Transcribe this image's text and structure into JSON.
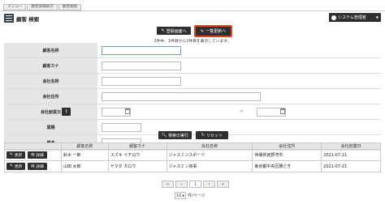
{
  "tabs": [
    "メニュー",
    "顧客詳細表示",
    "顧客検索"
  ],
  "header": {
    "title": "顧客 検索",
    "user_label": "システム管理者"
  },
  "actions": {
    "register_label": "登録画面へ",
    "bulk_update_label": "一覧更新へ"
  },
  "result_summary": "2件中、1件目から2件目を表示しています。",
  "form": {
    "customer_name_label": "顧客名称",
    "customer_kana_label": "顧客カナ",
    "company_name_label": "会社名称",
    "company_address_label": "会社住所",
    "founded_date_label": "会社創業日",
    "range_separator": "~",
    "industry_label": "業種",
    "remarks_label": "備考"
  },
  "search": {
    "search_label": "検索の実行",
    "reset_label": "リセット"
  },
  "table": {
    "columns": [
      "顧客名称",
      "顧客カナ",
      "会社名称",
      "会社住所",
      "会社創業日"
    ],
    "update_label": "更新",
    "detail_label": "詳細",
    "rows": [
      {
        "name": "鈴木 一郎",
        "kana": "スズキ イチロウ",
        "company": "ジャスミンスポーツ",
        "address": "仲縄県宮野湾市",
        "founded": "2021-07-21"
      },
      {
        "name": "山田 太郎",
        "kana": "ヤマダ タロウ",
        "company": "ジャスミン商事",
        "address": "東京都中央区勝どき",
        "founded": "2021-07-21"
      }
    ]
  },
  "pagination": {
    "first": "«",
    "prev": "‹",
    "current": "1",
    "next": "›",
    "last": "»",
    "per_page_value": "10",
    "per_page_suffix": "件/ページ"
  }
}
